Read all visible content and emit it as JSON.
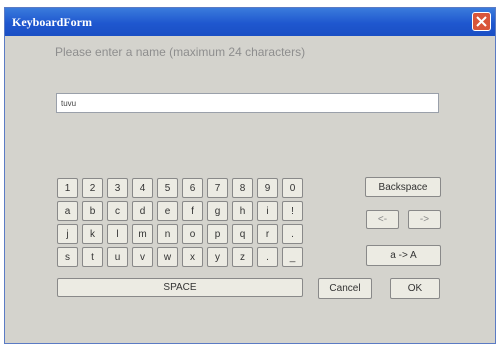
{
  "window": {
    "title": "KeyboardForm"
  },
  "prompt": "Please enter a name (maximum 24 characters)",
  "name_field": {
    "value": "tuvu"
  },
  "keyboard": {
    "rows": [
      [
        "1",
        "2",
        "3",
        "4",
        "5",
        "6",
        "7",
        "8",
        "9",
        "0"
      ],
      [
        "a",
        "b",
        "c",
        "d",
        "e",
        "f",
        "g",
        "h",
        "i",
        "!"
      ],
      [
        "j",
        "k",
        "l",
        "m",
        "n",
        "o",
        "p",
        "q",
        "r",
        "."
      ],
      [
        "s",
        "t",
        "u",
        "v",
        "w",
        "x",
        "y",
        "z",
        ".",
        "_"
      ]
    ],
    "space_label": "SPACE"
  },
  "buttons": {
    "backspace": "Backspace",
    "left": "<-",
    "right": "->",
    "case": "a -> A",
    "cancel": "Cancel",
    "ok": "OK"
  },
  "icons": {
    "close": "close-icon"
  },
  "colors": {
    "titlebar": "#1f57cf",
    "close": "#d9553a",
    "body": "#d4d3cd"
  }
}
